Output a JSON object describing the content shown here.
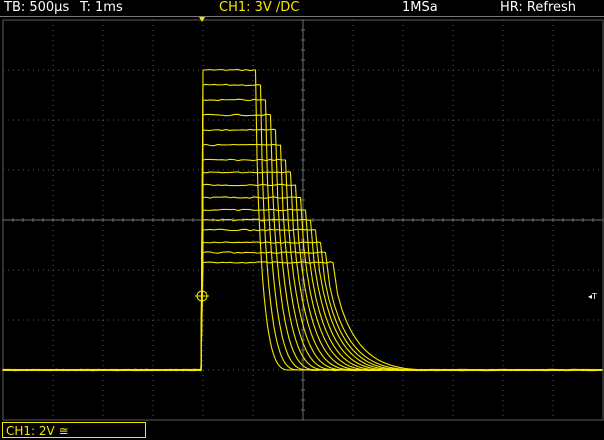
{
  "status_bar": {
    "timebase": "TB: 500µs",
    "trigger_time": "T: 1ms",
    "channel": "CH1: 3V ∕DC",
    "sample_rate": "1MSa",
    "acquisition_mode": "HR: Refresh"
  },
  "screen": {
    "trigger_level_marker": "◂T"
  },
  "bottom_bar": {
    "channel_scale": "CH1: 2V ≅"
  },
  "colors": {
    "trace": "#f5e800",
    "grid": "#5a5a5a",
    "grid_dots": "#6e6e6e",
    "background": "#000000"
  },
  "chart_data": {
    "type": "line",
    "title": "",
    "xlabel": "",
    "ylabel": "",
    "grid": true,
    "time_per_div_us": 500,
    "volts_per_div": 2,
    "x_divisions": 12,
    "y_divisions": 8,
    "baseline_div": -3,
    "pulse_start_div": -2,
    "series": [
      {
        "level_div": 3,
        "fall_start_div": -0.95
      },
      {
        "level_div": 2.7,
        "fall_start_div": -0.85
      },
      {
        "level_div": 2.4,
        "fall_start_div": -0.75
      },
      {
        "level_div": 2.1,
        "fall_start_div": -0.65
      },
      {
        "level_div": 1.8,
        "fall_start_div": -0.55
      },
      {
        "level_div": 1.5,
        "fall_start_div": -0.45
      },
      {
        "level_div": 1.2,
        "fall_start_div": -0.35
      },
      {
        "level_div": 0.95,
        "fall_start_div": -0.25
      },
      {
        "level_div": 0.7,
        "fall_start_div": -0.15
      },
      {
        "level_div": 0.45,
        "fall_start_div": -0.05
      },
      {
        "level_div": 0.2,
        "fall_start_div": 0.05
      },
      {
        "level_div": 0.0,
        "fall_start_div": 0.15
      },
      {
        "level_div": -0.2,
        "fall_start_div": 0.25
      },
      {
        "level_div": -0.45,
        "fall_start_div": 0.35
      },
      {
        "level_div": -0.65,
        "fall_start_div": 0.45
      },
      {
        "level_div": -0.85,
        "fall_start_div": 0.6
      }
    ]
  }
}
